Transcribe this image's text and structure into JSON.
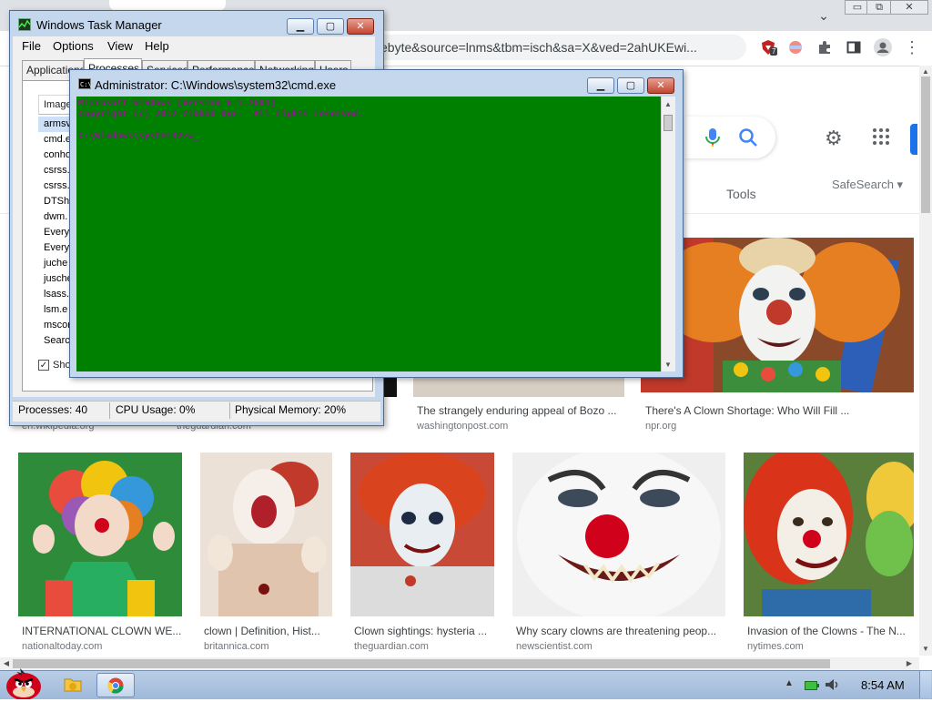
{
  "chrome": {
    "url_text": "ebyte&source=lnms&tbm=isch&sa=X&ved=2ahUKEwi...",
    "tab_menu_icon": "chevron-down-icon",
    "window_minimize_glyph": "▭",
    "window_restore_glyph": "⧉",
    "window_close_glyph": "✕",
    "extension_badge": "7",
    "extension_icons": [
      "shield-extension-icon",
      "colorful-extension-icon",
      "puzzle-icon",
      "side-panel-icon",
      "profile-avatar-icon",
      "more-vert-icon"
    ],
    "more_glyph": "⋮"
  },
  "google": {
    "tools_label": "Tools",
    "safesearch_label": "SafeSearch ▾",
    "settings_glyph": "⚙",
    "apps_glyph": "⠿",
    "accent_blue": "#1a73e8"
  },
  "results_row1": [
    {
      "caption": "",
      "source": "en.wikipedia.org"
    },
    {
      "caption": "",
      "source": "theguardian.com"
    },
    {
      "caption": "The strangely enduring appeal of Bozo ...",
      "source": "washingtonpost.com"
    },
    {
      "caption": "There's A Clown Shortage: Who Will Fill ...",
      "source": "npr.org"
    }
  ],
  "results_row2": [
    {
      "caption": "INTERNATIONAL CLOWN WE...",
      "source": "nationaltoday.com"
    },
    {
      "caption": "clown | Definition, Hist...",
      "source": "britannica.com"
    },
    {
      "caption": "Clown sightings: hysteria ...",
      "source": "theguardian.com"
    },
    {
      "caption": "Why scary clowns are threatening peop...",
      "source": "newscientist.com"
    },
    {
      "caption": "Invasion of the Clowns - The N...",
      "source": "nytimes.com"
    }
  ],
  "task_manager": {
    "title": "Windows Task Manager",
    "menu": [
      "File",
      "Options",
      "View",
      "Help"
    ],
    "tabs": [
      "Applications",
      "Processes",
      "Services",
      "Performance",
      "Networking",
      "Users"
    ],
    "column_header": "Image",
    "processes": [
      "armsv",
      "cmd.e",
      "conho",
      "csrss.",
      "csrss.",
      "DTShe",
      "dwm.",
      "Every",
      "Every",
      "juche",
      "jusche",
      "lsass.",
      "lsm.e",
      "mscor",
      "Searc"
    ],
    "show_all_label": "Sho",
    "status": {
      "processes": "Processes: 40",
      "cpu": "CPU Usage: 0%",
      "memory": "Physical Memory: 20%"
    }
  },
  "cmd": {
    "title": "Administrator: C:\\Windows\\system32\\cmd.exe",
    "console_bg": "#008000",
    "text_color": "#8b1a89",
    "lines": [
      "Microsoft Windows [Version 6.1.7601]",
      "Copyright (c) 2012 Zibhad Kye.  All rights reserved.",
      "",
      "C:\\Windows\\system32>w_"
    ]
  },
  "taskbar": {
    "clock": "8:54 AM",
    "start_icon": "angry-bird-start-icon",
    "pinned": [
      "explorer-icon",
      "chrome-icon"
    ],
    "tray_icons": [
      "tray-expand-icon",
      "battery-icon",
      "volume-icon"
    ]
  }
}
